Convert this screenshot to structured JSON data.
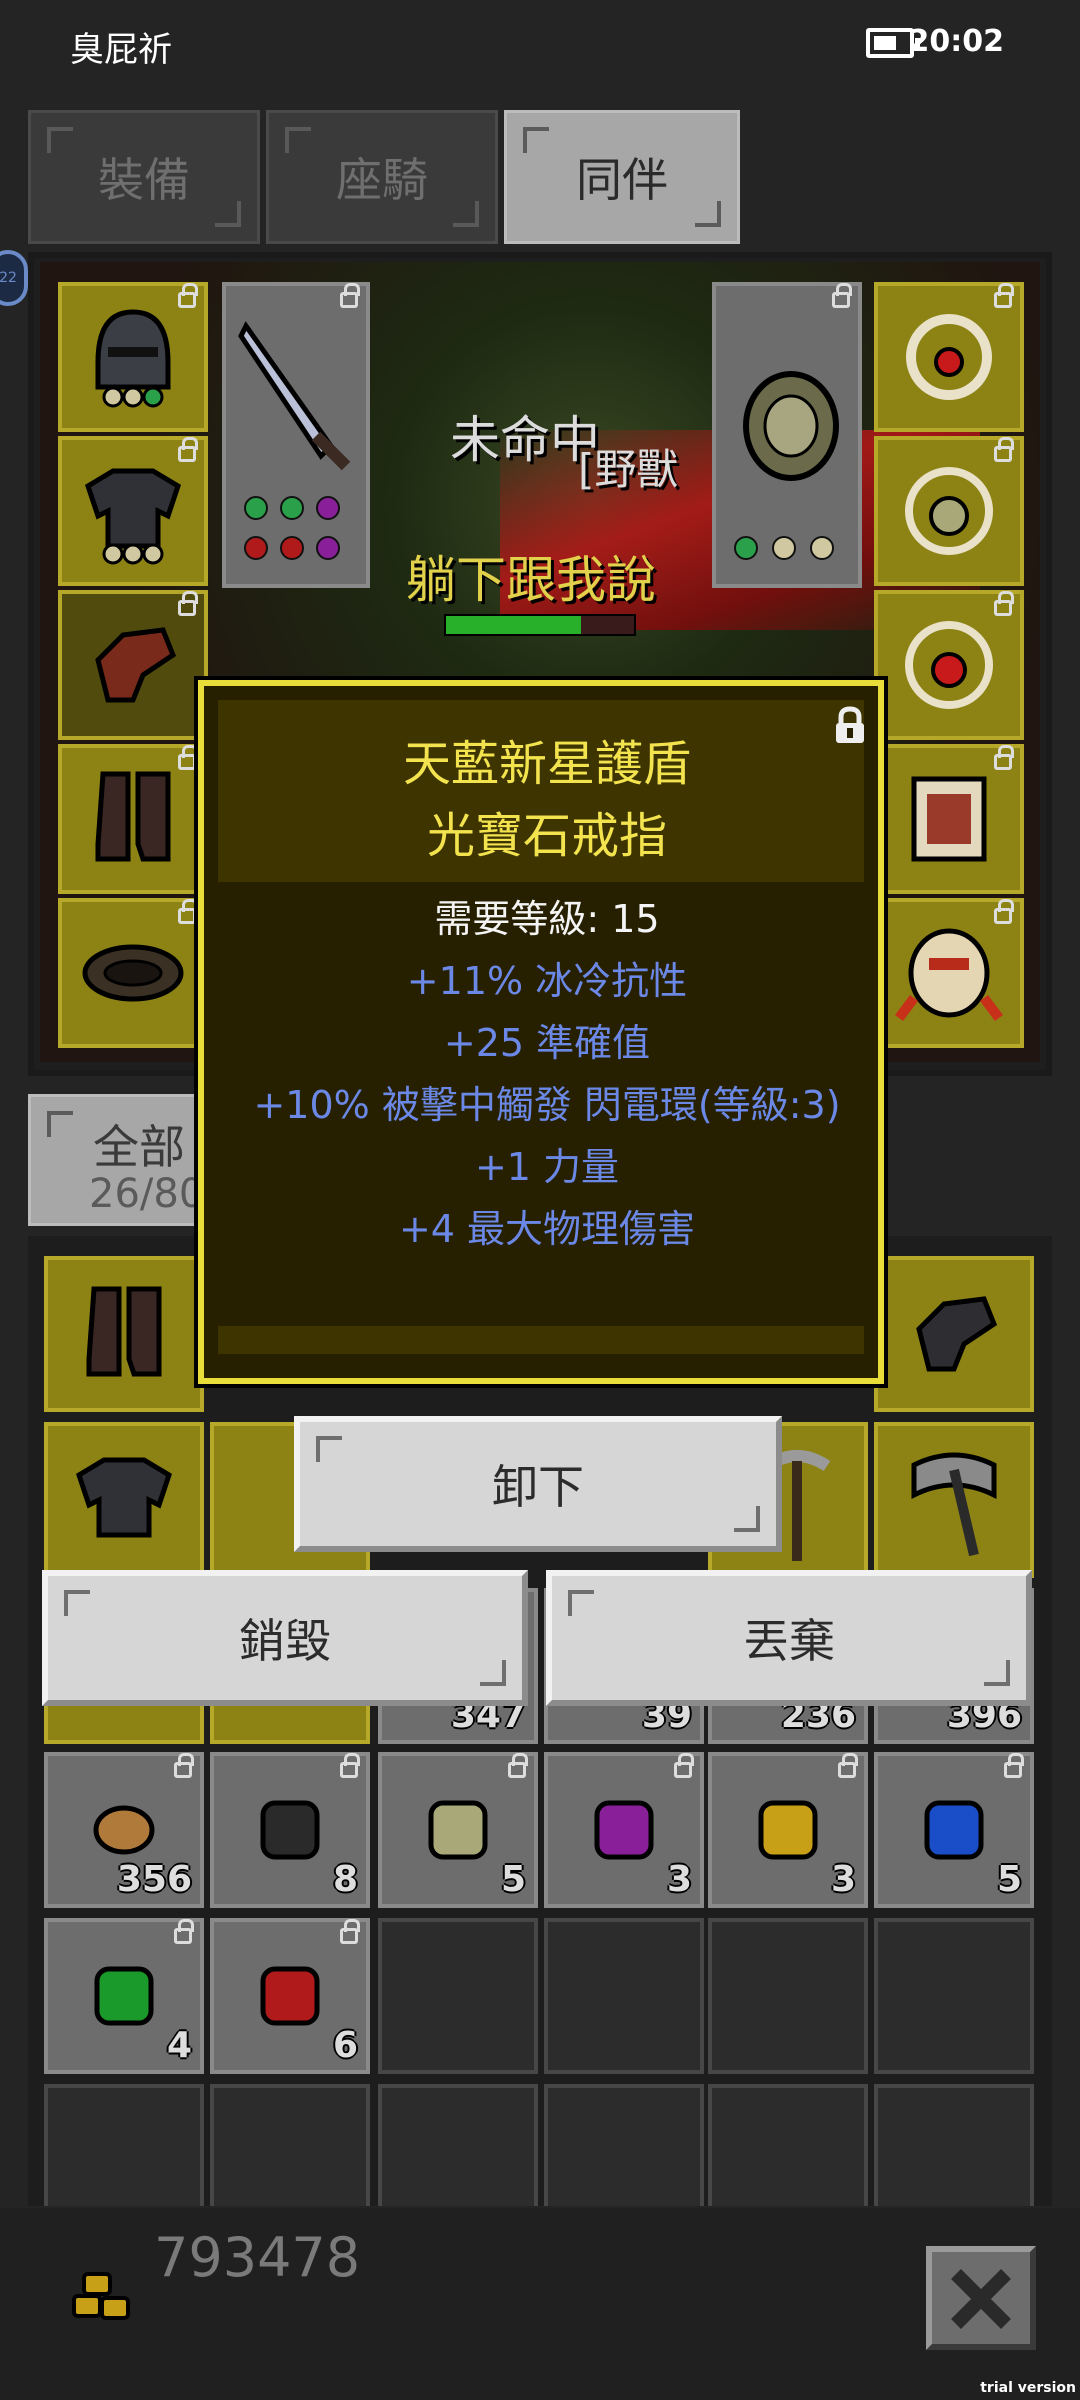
{
  "status_bar": {
    "title": "臭屁祈",
    "time": "20:02",
    "battery_icon": "battery-icon"
  },
  "top_tabs": [
    {
      "label": "裝備",
      "active": false
    },
    {
      "label": "座騎",
      "active": false
    },
    {
      "label": "同伴",
      "active": true
    }
  ],
  "side_badge": "22",
  "scene": {
    "miss_text": "未命中",
    "beast_text": "[野獸",
    "lie_text": "躺下跟我說",
    "hp_fraction": 0.72
  },
  "equipment": {
    "left_slots": [
      {
        "name": "helmet",
        "icon": "helmet-icon"
      },
      {
        "name": "chest-armor",
        "icon": "armor-icon"
      },
      {
        "name": "gloves",
        "icon": "glove-icon"
      },
      {
        "name": "boots",
        "icon": "boots-icon"
      },
      {
        "name": "belt",
        "icon": "belt-icon"
      }
    ],
    "right_slots": [
      {
        "name": "ring",
        "icon": "ring-icon"
      },
      {
        "name": "amulet",
        "icon": "amulet-icon"
      },
      {
        "name": "ring-2",
        "icon": "ring-icon"
      },
      {
        "name": "scroll",
        "icon": "scroll-icon"
      },
      {
        "name": "pet-bug",
        "icon": "beetle-icon"
      }
    ],
    "weapon": {
      "icon": "sword-icon"
    },
    "offhand": {
      "icon": "shield-icon"
    }
  },
  "inventory_tab": {
    "label": "全部",
    "capacity": "26/80"
  },
  "tooltip": {
    "name_line1": "天藍新星護盾",
    "name_line2": "光寶石戒指",
    "requirement": "需要等級: 15",
    "stats": [
      "+11% 冰冷抗性",
      "+25 準確值",
      "+10% 被擊中觸發 閃電環(等級:3)",
      "+1 力量",
      "+4 最大物理傷害"
    ],
    "lock_icon": "lock-icon"
  },
  "actions": {
    "unequip": "卸下",
    "destroy": "銷毀",
    "discard": "丟棄"
  },
  "inventory_rows": {
    "partial_counts": [
      "347",
      "39",
      "236",
      "396"
    ],
    "materials": [
      {
        "icon": "ore-icon",
        "count": "356",
        "color": "#b07a3a"
      },
      {
        "icon": "dark-gem-icon",
        "count": "8",
        "color": "#2a2a2a"
      },
      {
        "icon": "pale-gem-icon",
        "count": "5",
        "color": "#a8a878"
      },
      {
        "icon": "purple-gem-icon",
        "count": "3",
        "color": "#8a1f9a"
      },
      {
        "icon": "yellow-gem-icon",
        "count": "3",
        "color": "#c8a018"
      },
      {
        "icon": "blue-gem-icon",
        "count": "5",
        "color": "#1a4ec8"
      },
      {
        "icon": "green-gem-icon",
        "count": "4",
        "color": "#1a9a2a"
      },
      {
        "icon": "red-gem-icon",
        "count": "6",
        "color": "#b01a1a"
      }
    ]
  },
  "gold": {
    "value": "793478",
    "icon": "gold-coins-icon"
  },
  "close_icon": "close-icon",
  "watermark": "trial version"
}
